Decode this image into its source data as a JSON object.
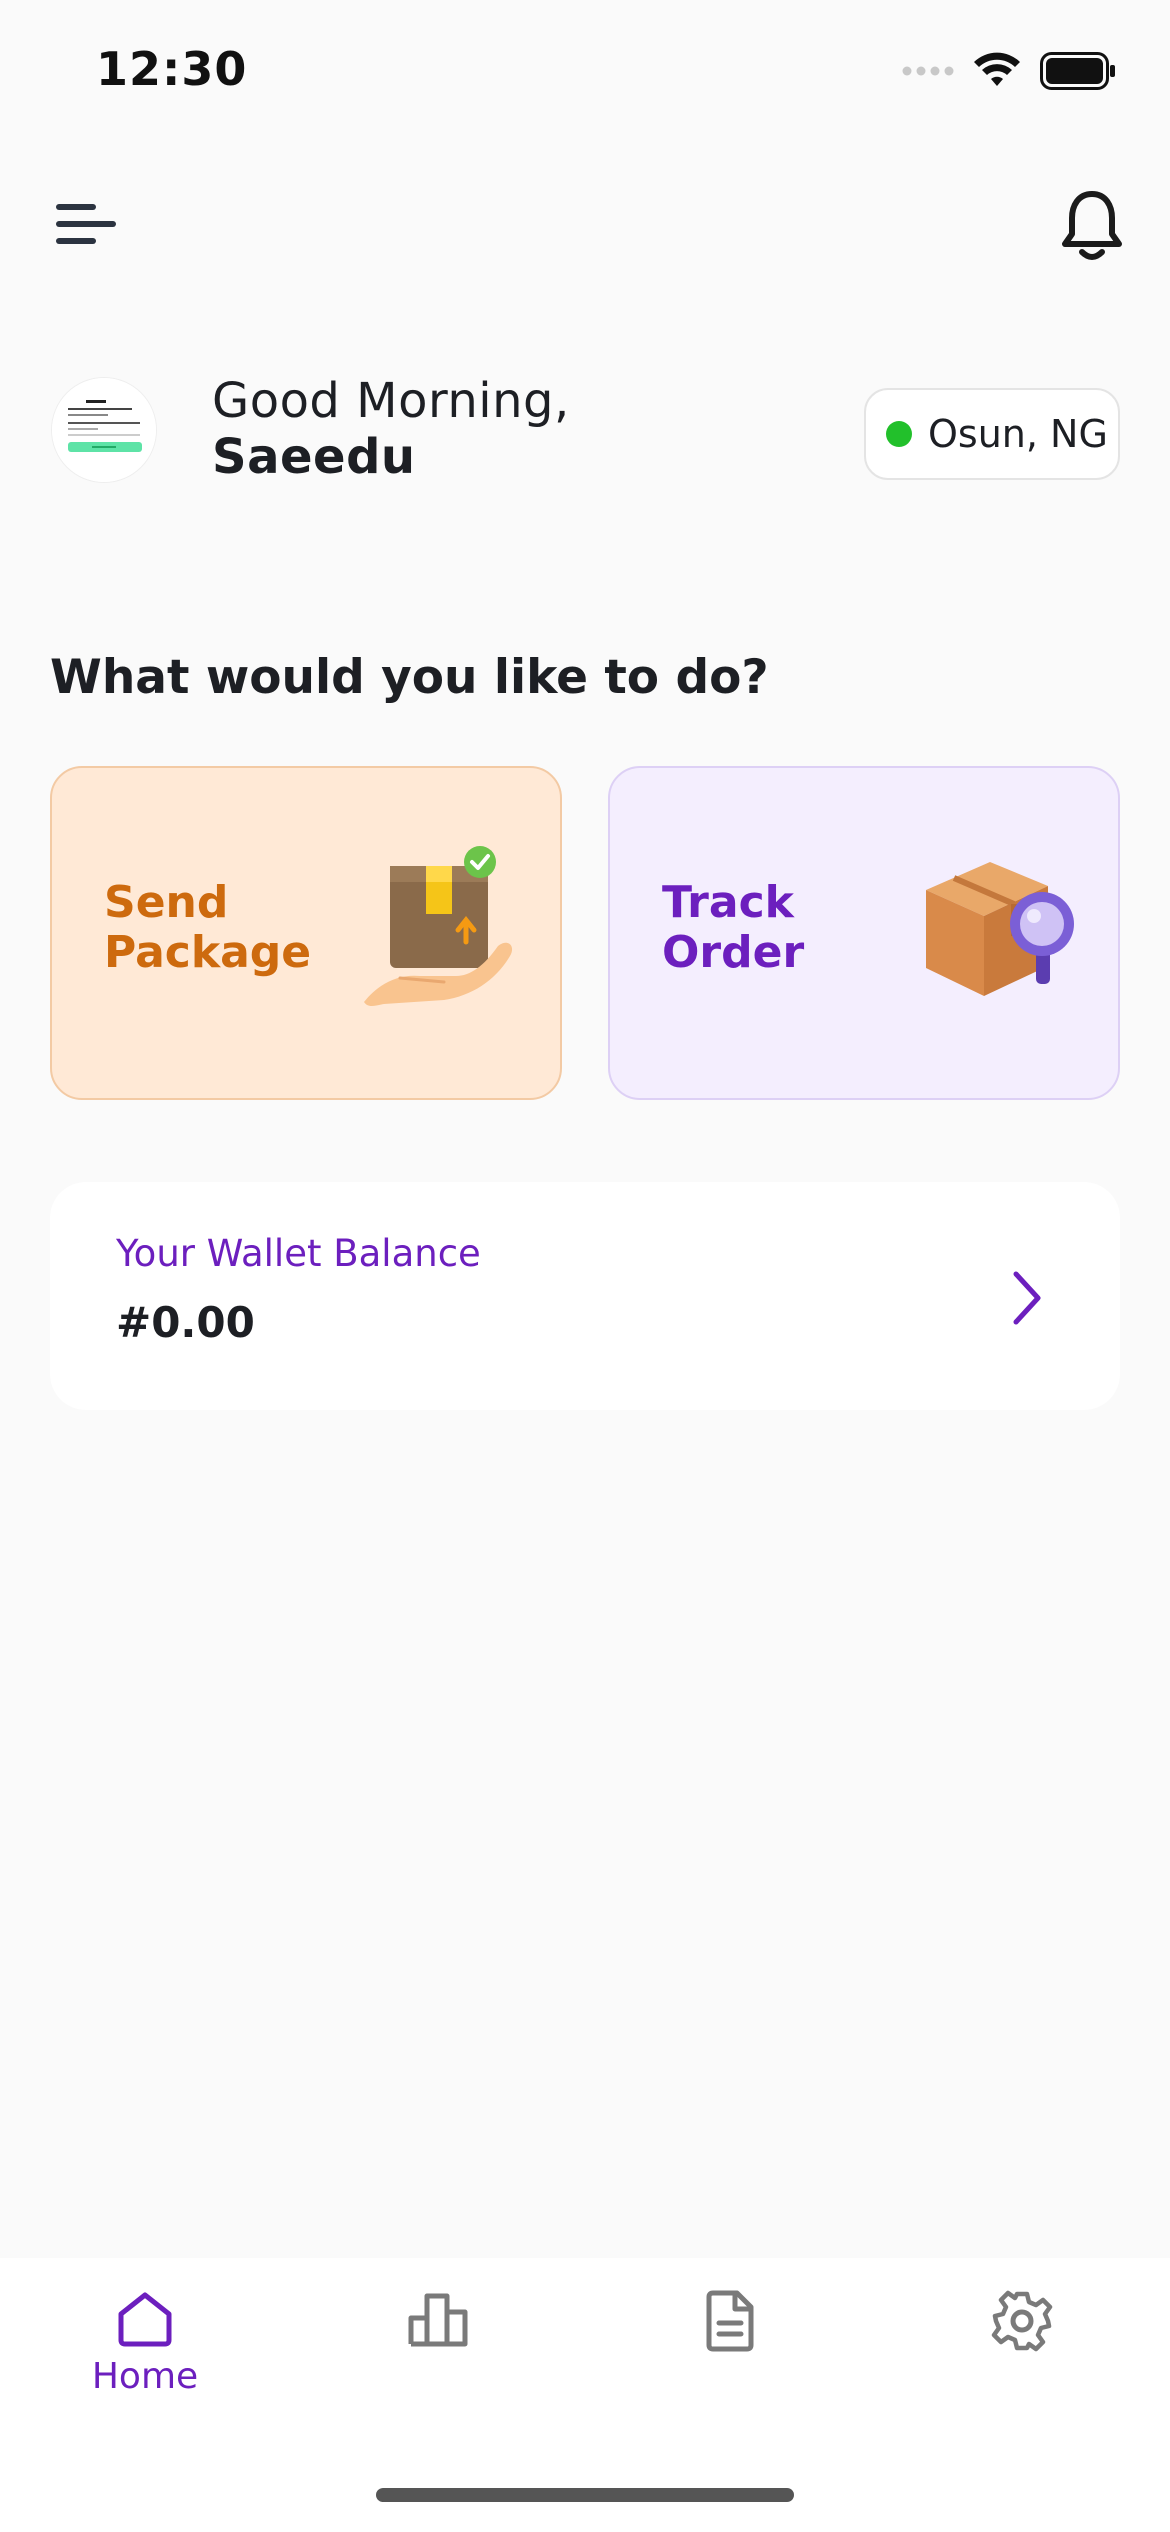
{
  "status_bar": {
    "time": "12:30"
  },
  "header": {
    "menu_icon": "menu-icon",
    "notification_icon": "bell-icon"
  },
  "greeting": {
    "line": "Good Morning,",
    "name": "Saeedu"
  },
  "location": {
    "label": "Osun, NG",
    "status_color": "#22c02b"
  },
  "section_title": "What would you like to do?",
  "actions": [
    {
      "label": "Send\nPackage",
      "icon": "package-hand-icon",
      "color": "#cd6a0e",
      "background": "#ffe9d6"
    },
    {
      "label": "Track\nOrder",
      "icon": "package-search-icon",
      "color": "#6c1fbe",
      "background": "#f4eefe"
    }
  ],
  "wallet": {
    "label": "Your Wallet Balance",
    "value": "#0.00"
  },
  "bottom_nav": {
    "items": [
      {
        "label": "Home",
        "icon": "home-icon",
        "active": true
      },
      {
        "label": "",
        "icon": "bar-chart-icon",
        "active": false
      },
      {
        "label": "",
        "icon": "document-icon",
        "active": false
      },
      {
        "label": "",
        "icon": "settings-gear-icon",
        "active": false
      }
    ]
  },
  "accent_color": "#6c1fbe"
}
